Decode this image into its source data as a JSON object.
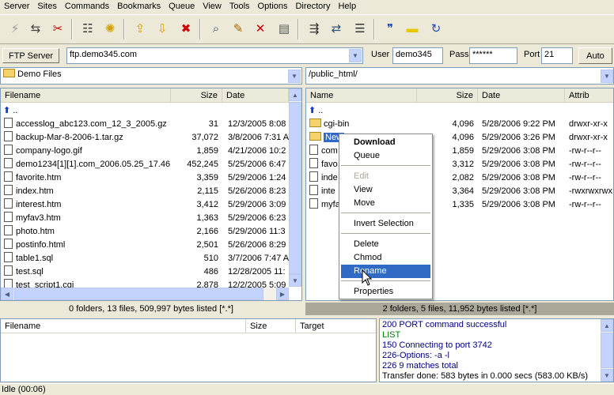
{
  "menu": [
    "Server",
    "Sites",
    "Commands",
    "Bookmarks",
    "Queue",
    "View",
    "Tools",
    "Options",
    "Directory",
    "Help"
  ],
  "toolbar_icons": [
    "disconnect-icon",
    "connect-icon",
    "cancel-icon",
    "site-manager-icon",
    "wizard-icon",
    "folder-upload-icon",
    "folder-download-icon",
    "folder-delete-icon",
    "find-icon",
    "edit-icon",
    "delete-icon",
    "properties-icon",
    "transfer-icon",
    "sync-icon",
    "script-icon",
    "quote-icon",
    "folder-icon",
    "refresh-icon"
  ],
  "connection": {
    "server_button": "FTP Server",
    "host": "ftp.demo345.com",
    "user_label": "User",
    "user": "demo345",
    "pass_label": "Pass",
    "pass": "******",
    "port_label": "Port",
    "port": "21",
    "auto_button": "Auto"
  },
  "local": {
    "path": "Demo Files",
    "headers": {
      "name": "Filename",
      "size": "Size",
      "date": "Date"
    },
    "up": "..",
    "files": [
      {
        "name": "accesslog_abc123.com_12_3_2005.gz",
        "size": "31",
        "date": "12/3/2005 8:08"
      },
      {
        "name": "backup-Mar-8-2006-1.tar.gz",
        "size": "37,072",
        "date": "3/8/2006 7:31 A"
      },
      {
        "name": "company-logo.gif",
        "size": "1,859",
        "date": "4/21/2006 10:2"
      },
      {
        "name": "demo1234[1][1].com_2006.05.25_17.46",
        "size": "452,245",
        "date": "5/25/2006 6:47"
      },
      {
        "name": "favorite.htm",
        "size": "3,359",
        "date": "5/29/2006 1:24"
      },
      {
        "name": "index.htm",
        "size": "2,115",
        "date": "5/26/2006 8:23"
      },
      {
        "name": "interest.htm",
        "size": "3,412",
        "date": "5/29/2006 3:09"
      },
      {
        "name": "myfav3.htm",
        "size": "1,363",
        "date": "5/29/2006 6:23"
      },
      {
        "name": "photo.htm",
        "size": "2,166",
        "date": "5/29/2006 11:3"
      },
      {
        "name": "postinfo.html",
        "size": "2,501",
        "date": "5/26/2006 8:29"
      },
      {
        "name": "table1.sql",
        "size": "510",
        "date": "3/7/2006 7:47 A"
      },
      {
        "name": "test.sql",
        "size": "486",
        "date": "12/28/2005 11:"
      },
      {
        "name": "test_script1.cgi",
        "size": "2,878",
        "date": "12/2/2005 5:09"
      }
    ],
    "status": "0 folders, 13 files, 509,997 bytes listed [*.*]"
  },
  "remote": {
    "path": "/public_html/",
    "headers": {
      "name": "Name",
      "size": "Size",
      "date": "Date",
      "attrib": "Attrib"
    },
    "up": "..",
    "files": [
      {
        "name": "cgi-bin",
        "size": "4,096",
        "date": "5/28/2006 9:22 PM",
        "attrib": "drwxr-xr-x",
        "folder": true
      },
      {
        "name": "New",
        "size": "4,096",
        "date": "5/29/2006 3:26 PM",
        "attrib": "drwxr-xr-x",
        "folder": true
      },
      {
        "name": "com",
        "size": "1,859",
        "date": "5/29/2006 3:08 PM",
        "attrib": "-rw-r--r--"
      },
      {
        "name": "favo",
        "size": "3,312",
        "date": "5/29/2006 3:08 PM",
        "attrib": "-rw-r--r--"
      },
      {
        "name": "inde",
        "size": "2,082",
        "date": "5/29/2006 3:08 PM",
        "attrib": "-rw-r--r--"
      },
      {
        "name": "inte",
        "size": "3,364",
        "date": "5/29/2006 3:08 PM",
        "attrib": "-rwxrwxrwx"
      },
      {
        "name": "myfa",
        "size": "1,335",
        "date": "5/29/2006 3:08 PM",
        "attrib": "-rw-r--r--"
      }
    ],
    "status": "2 folders, 5 files, 11,952 bytes listed [*.*]"
  },
  "context_menu": {
    "download": "Download",
    "queue": "Queue",
    "edit": "Edit",
    "view": "View",
    "move": "Move",
    "invert": "Invert Selection",
    "delete": "Delete",
    "chmod": "Chmod",
    "rename": "Rename",
    "properties": "Properties"
  },
  "queue": {
    "headers": {
      "name": "Filename",
      "size": "Size",
      "target": "Target"
    }
  },
  "log": [
    {
      "text": "200 PORT command successful",
      "color": "#000080"
    },
    {
      "text": "LIST",
      "color": "#008000"
    },
    {
      "text": "150 Connecting to port 3742",
      "color": "#000080"
    },
    {
      "text": "226-Options: -a -l",
      "color": "#000080"
    },
    {
      "text": "226 9 matches total",
      "color": "#000080"
    },
    {
      "text": "Transfer done: 583 bytes in 0.000 secs (583.00 KB/s)",
      "color": "#000000"
    }
  ],
  "statusbar": "Idle (00:06)"
}
